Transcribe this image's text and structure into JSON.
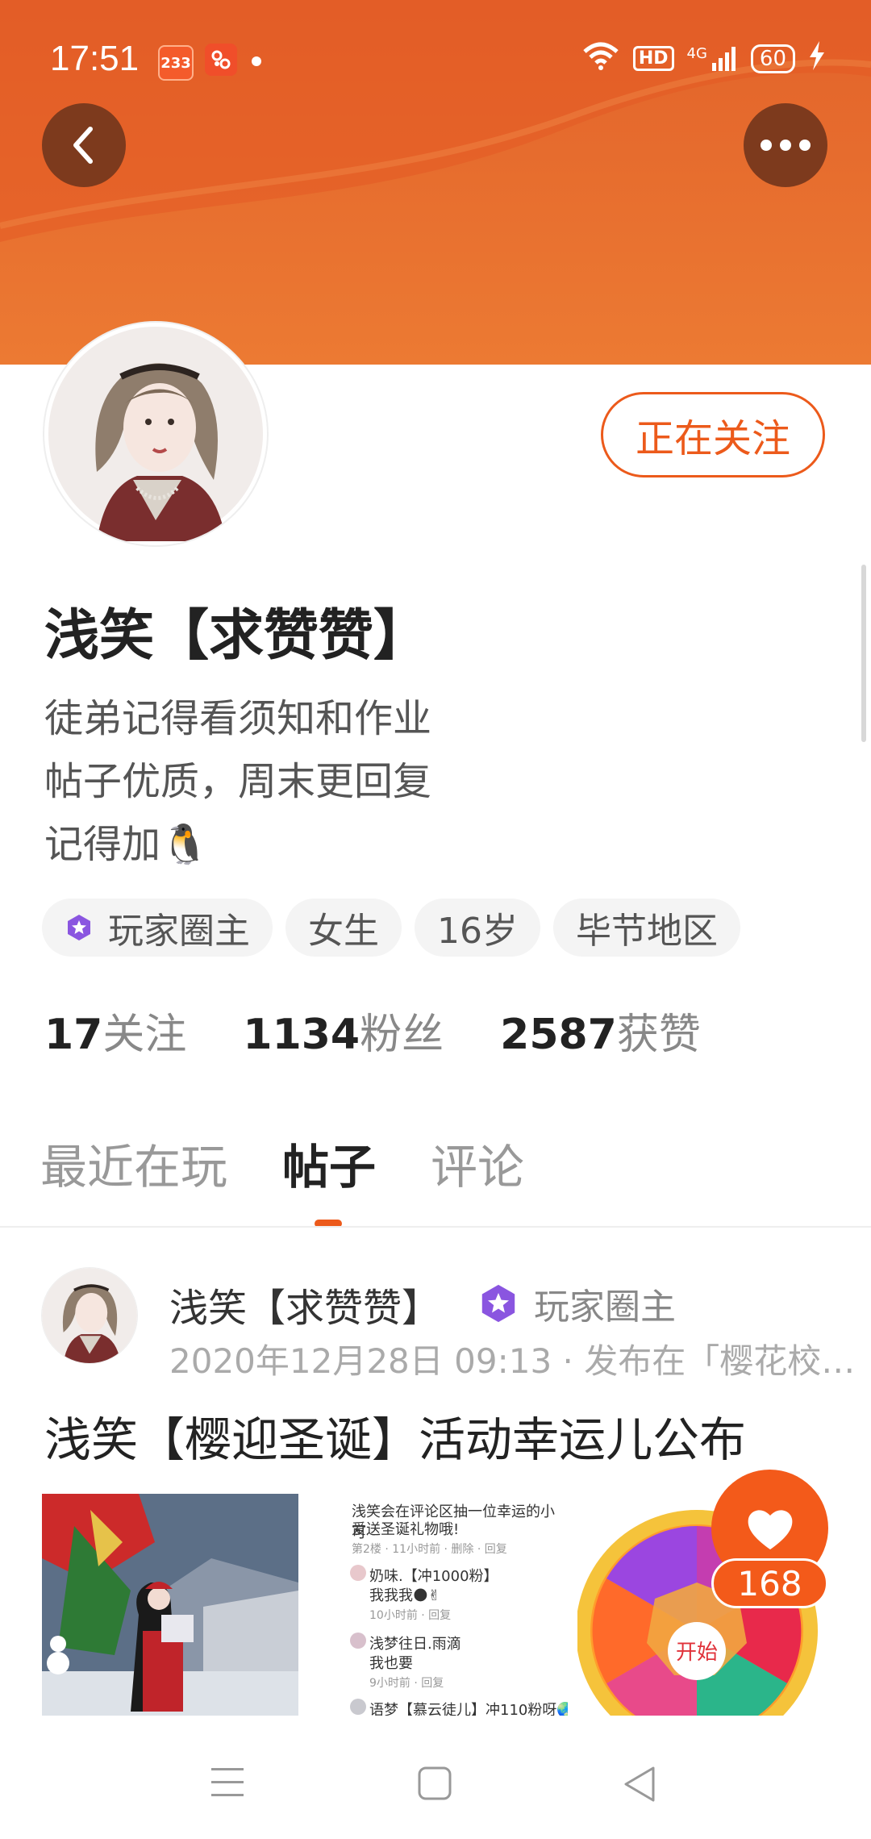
{
  "status_bar": {
    "time": "17:51",
    "badge_233": "233",
    "hd": "HD",
    "network": "4G",
    "battery": "60"
  },
  "profile": {
    "follow_button": "正在关注",
    "name": "浅笑【求赞赞】",
    "bio": [
      "徒弟记得看须知和作业",
      "帖子优质，周末更回复",
      "记得加🐧"
    ],
    "tags": [
      "玩家圈主",
      "女生",
      "16岁",
      "毕节地区"
    ],
    "stats": [
      {
        "num": "17",
        "label": "关注"
      },
      {
        "num": "1134",
        "label": "粉丝"
      },
      {
        "num": "2587",
        "label": "获赞"
      }
    ]
  },
  "tabs": [
    "最近在玩",
    "帖子",
    "评论"
  ],
  "active_tab": "帖子",
  "post": {
    "author": "浅笑【求赞赞】",
    "badge": "玩家圈主",
    "meta": "2020年12月28日 09:13 · 发布在「樱花校…",
    "title": "浅笑【樱迎圣诞】活动幸运儿公布",
    "comment_image": {
      "line1": "浅笑会在评论区抽一位幸运的小可",
      "line2": "爱送圣诞礼物哦!",
      "line3": "第2楼 · 11小时前 · 删除 · 回复",
      "c1_name": "奶味.【冲1000粉】",
      "c1_text": "我我我🌑✌",
      "c1_time": "10小时前 · 回复",
      "c2_name": "浅梦往日.雨滴",
      "c2_text": "我也要",
      "c2_time": "9小时前 · 回复",
      "c3_name": "语梦【慕云徒儿】冲110粉呀🌏"
    },
    "wheel_label": "开始",
    "likes": "168"
  },
  "colors": {
    "accent": "#ec5a1b",
    "header": "#e8692d",
    "icon_bg": "#7d3a1d"
  },
  "icons": [
    "back-icon",
    "more-icon",
    "wifi-icon",
    "signal-icon",
    "charging-icon",
    "heart-icon",
    "menu-icon",
    "home-icon",
    "back-nav-icon"
  ]
}
